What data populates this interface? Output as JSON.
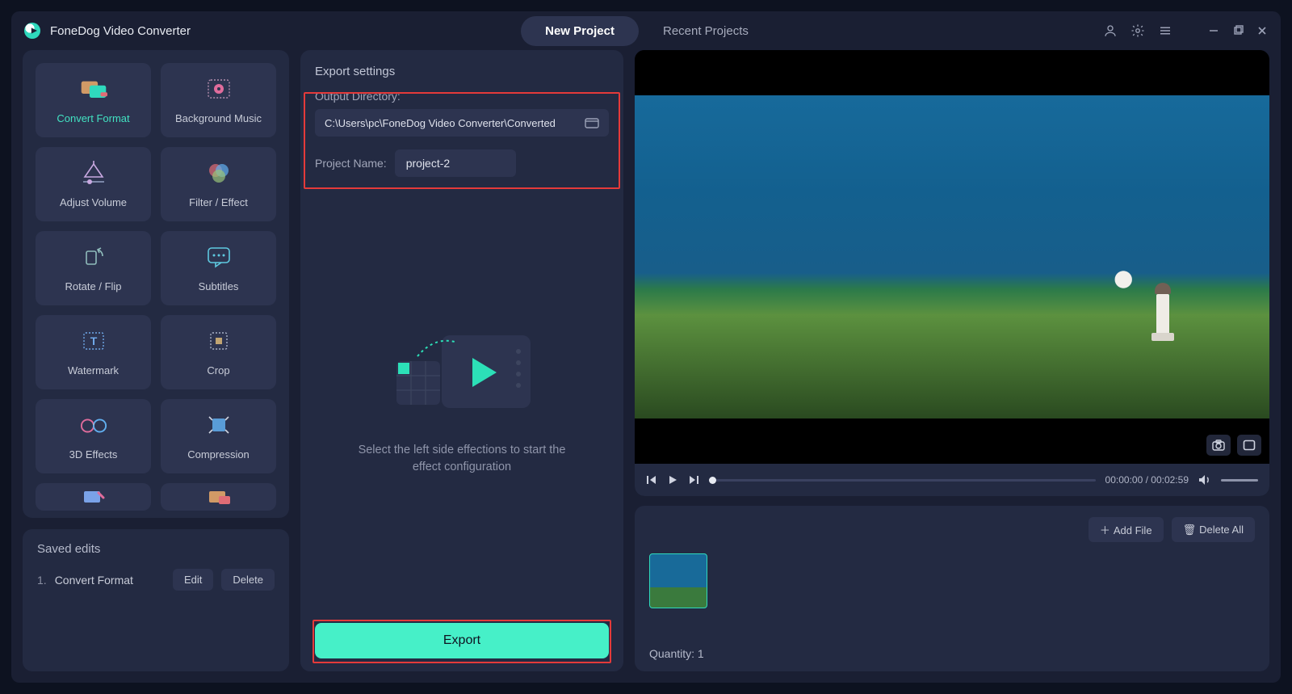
{
  "app": {
    "title": "FoneDog Video Converter"
  },
  "tabs": {
    "new_project": "New Project",
    "recent_projects": "Recent Projects"
  },
  "tools": {
    "convert_format": "Convert Format",
    "background_music": "Background Music",
    "adjust_volume": "Adjust Volume",
    "filter_effect": "Filter / Effect",
    "rotate_flip": "Rotate / Flip",
    "subtitles": "Subtitles",
    "watermark": "Watermark",
    "crop": "Crop",
    "three_d": "3D Effects",
    "compression": "Compression"
  },
  "saved": {
    "title": "Saved edits",
    "items": [
      {
        "idx": "1.",
        "name": "Convert Format"
      }
    ],
    "edit": "Edit",
    "delete": "Delete"
  },
  "export": {
    "section_title": "Export settings",
    "output_dir_label": "Output Directory:",
    "output_dir_value": "C:\\Users\\pc\\FoneDog Video Converter\\Converted",
    "project_name_label": "Project Name:",
    "project_name_value": "project-2",
    "config_hint": "Select the left side effections to start the effect configuration",
    "button": "Export"
  },
  "player": {
    "time_current": "00:00:00",
    "time_total": "00:02:59"
  },
  "files": {
    "add_file": "Add File",
    "delete_all": "Delete All",
    "quantity_label": "Quantity:",
    "quantity_value": "1"
  }
}
